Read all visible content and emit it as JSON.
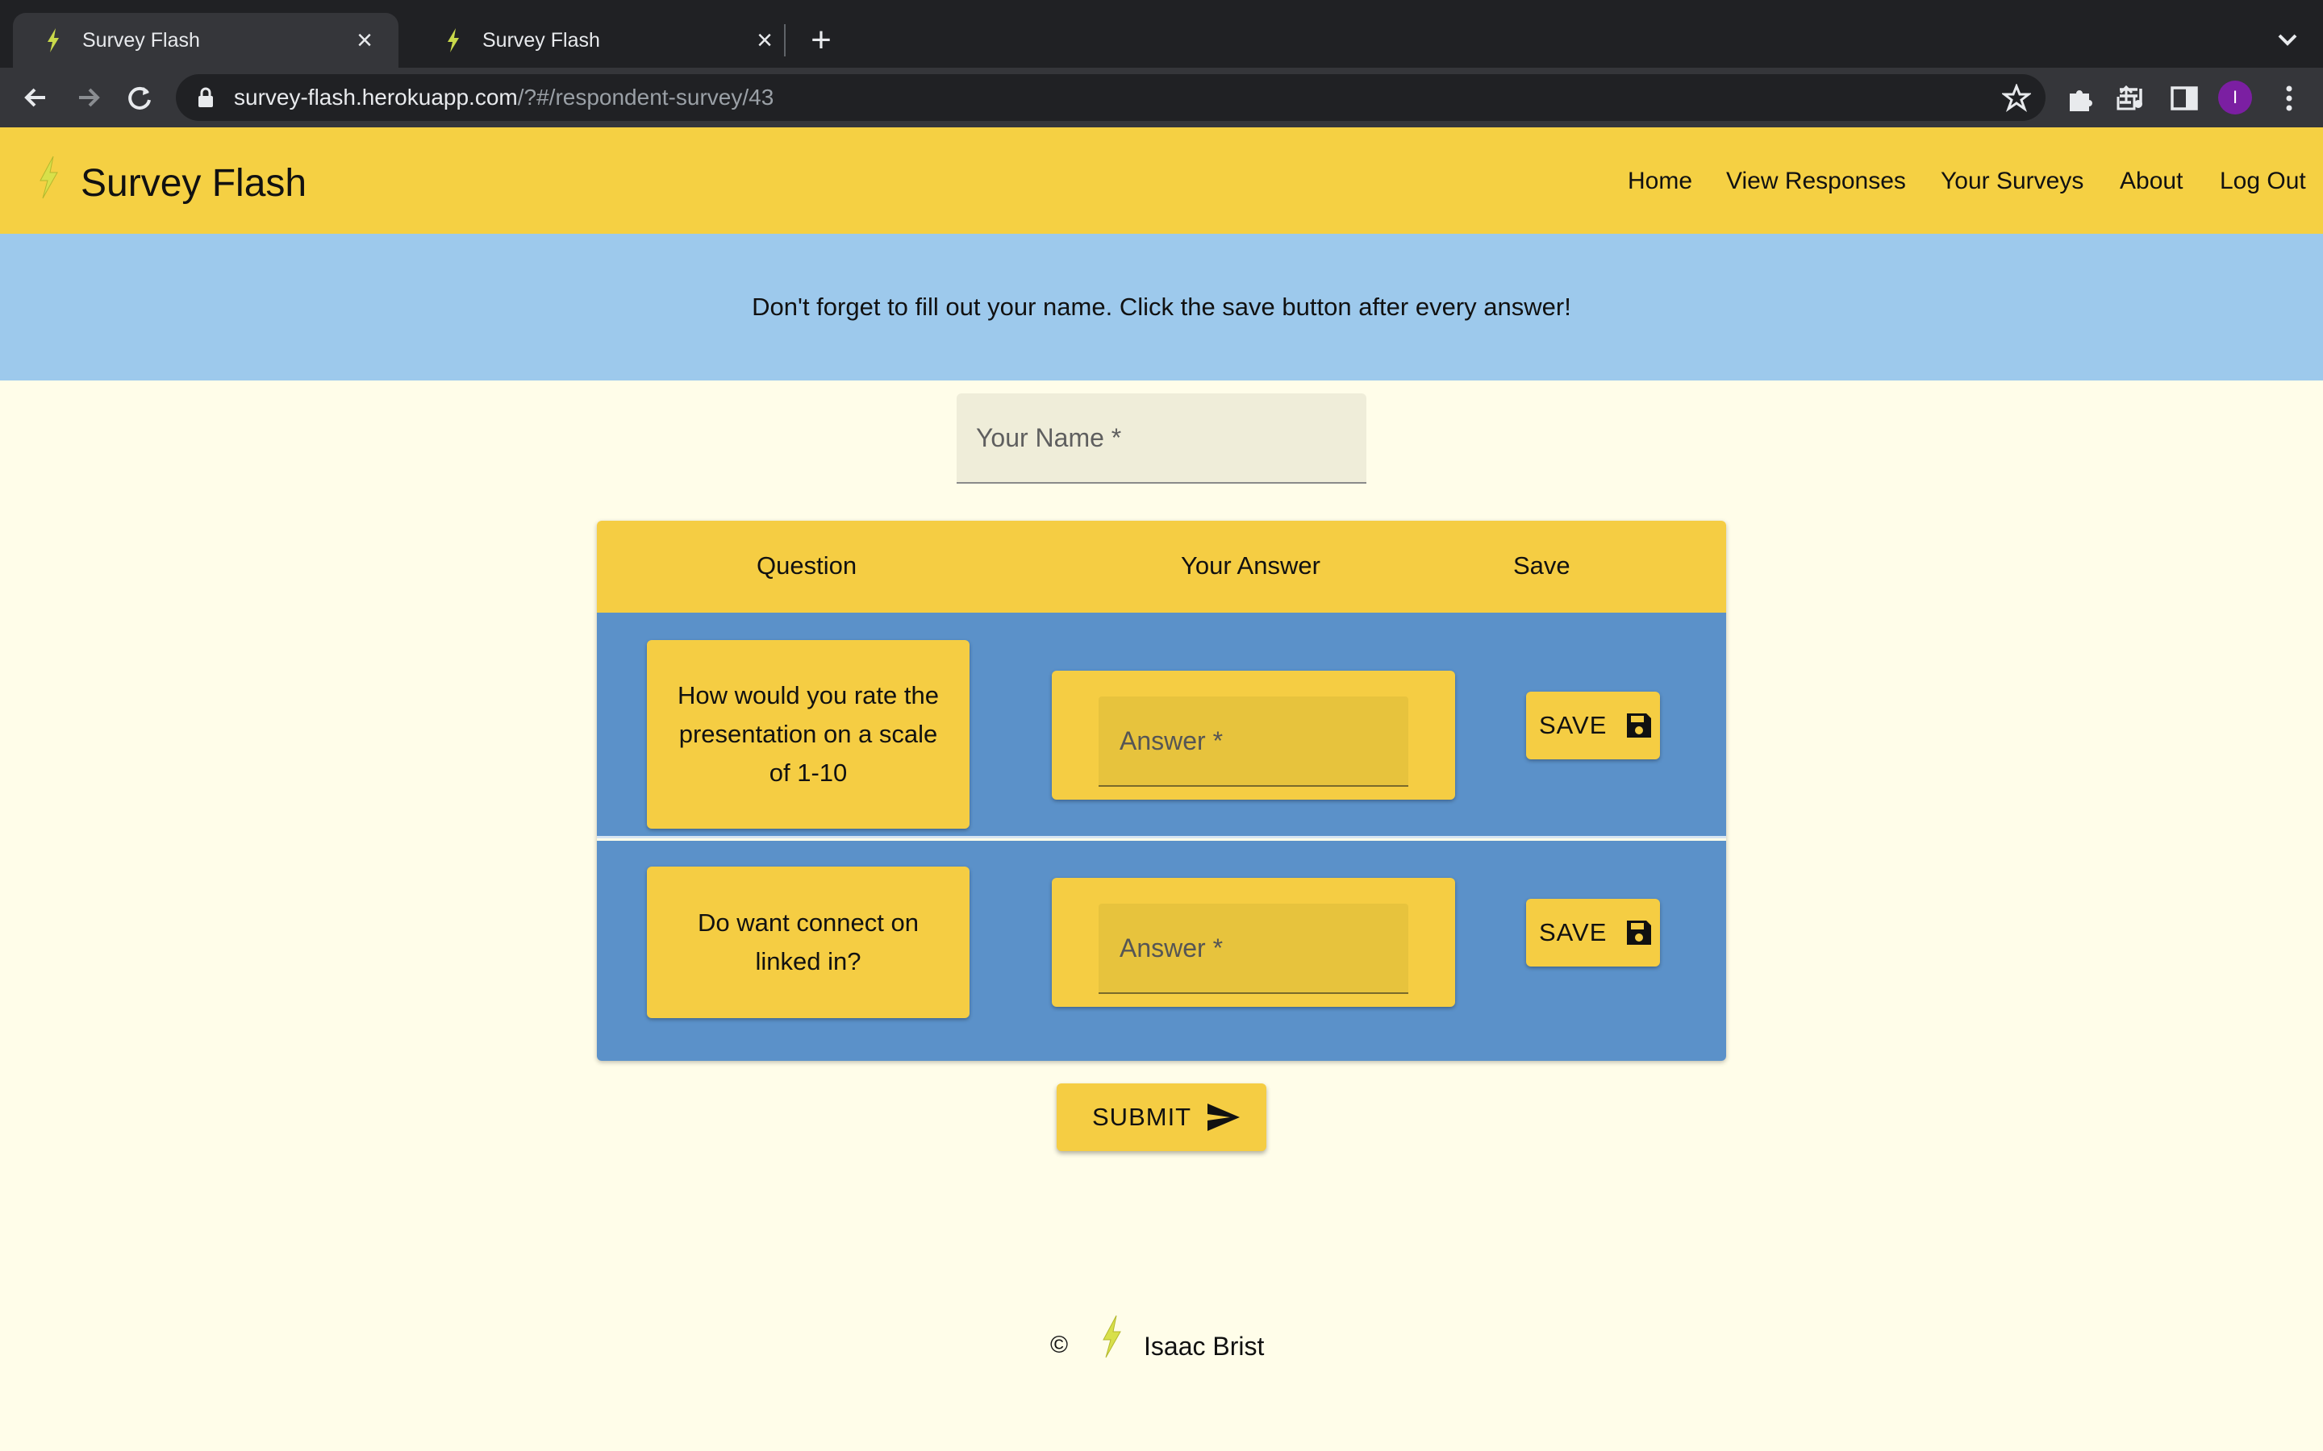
{
  "browser": {
    "tabs": [
      {
        "title": "Survey Flash",
        "active": true
      },
      {
        "title": "Survey Flash",
        "active": false
      }
    ],
    "url_host": "survey-flash.herokuapp.com",
    "url_path": "/?#/respondent-survey/43",
    "profile_initial": "I"
  },
  "header": {
    "brand": "Survey Flash",
    "nav": [
      "Home",
      "View Responses",
      "Your Surveys",
      "About",
      "Log Out"
    ]
  },
  "banner": {
    "text": "Don't forget to fill out your name. Click the save button after every answer!"
  },
  "name_field": {
    "placeholder": "Your Name *"
  },
  "table": {
    "headers": {
      "question": "Question",
      "answer": "Your Answer",
      "save": "Save"
    },
    "rows": [
      {
        "question": "How would you rate the presentation on a scale of 1-10",
        "answer_placeholder": "Answer *",
        "save_label": "SAVE"
      },
      {
        "question": "Do want connect on linked in?",
        "answer_placeholder": "Answer *",
        "save_label": "SAVE"
      }
    ]
  },
  "submit": {
    "label": "SUBMIT"
  },
  "footer": {
    "copyright": "©",
    "author": "Isaac Brist"
  },
  "colors": {
    "brand_yellow": "#f5d043",
    "banner_blue": "#9dc9ec",
    "row_blue": "#5b91c9",
    "page_bg": "#fffde9",
    "bolt": "#c9d94a"
  }
}
